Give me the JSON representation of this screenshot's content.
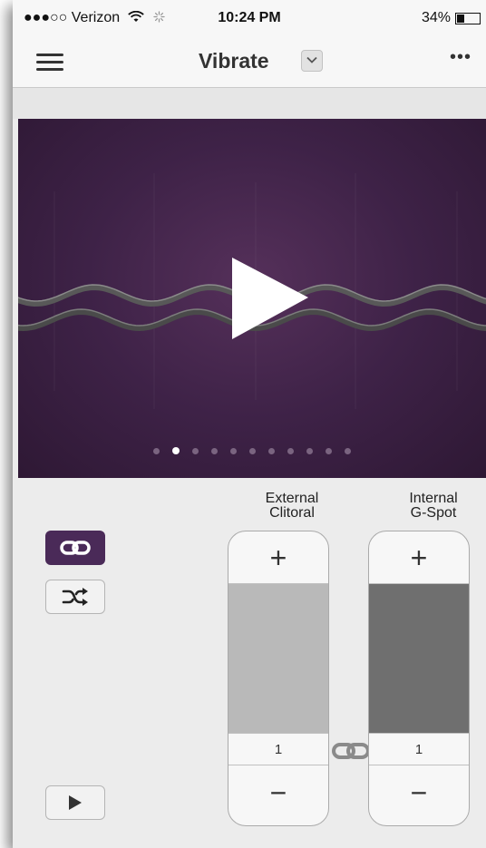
{
  "status_bar": {
    "carrier": "●●●○○ Verizon",
    "time": "10:24 PM",
    "battery": "34%",
    "battery_level": 0.34
  },
  "nav": {
    "title": "Vibrate",
    "more": "•••",
    "menu_icon": "hamburger-menu-icon",
    "dropdown_icon": "chevron-down-icon"
  },
  "pattern": {
    "page_count": 11,
    "active_page": 1,
    "play_icon": "play-icon"
  },
  "motors": [
    {
      "label_line1": "External",
      "label_line2": "Clitoral",
      "plus": "+",
      "minus": "−",
      "level": "1",
      "fill_color": "#b9b9b9"
    },
    {
      "label_line1": "Internal",
      "label_line2": "G-Spot",
      "plus": "+",
      "minus": "−",
      "level": "1",
      "fill_color": "#6f6f6f"
    }
  ],
  "side_buttons": {
    "link_icon": "link-icon",
    "shuffle_icon": "shuffle-icon",
    "play_icon": "play-icon"
  },
  "colors": {
    "accent": "#4a2a58",
    "panel_bg": "#3e2247"
  }
}
